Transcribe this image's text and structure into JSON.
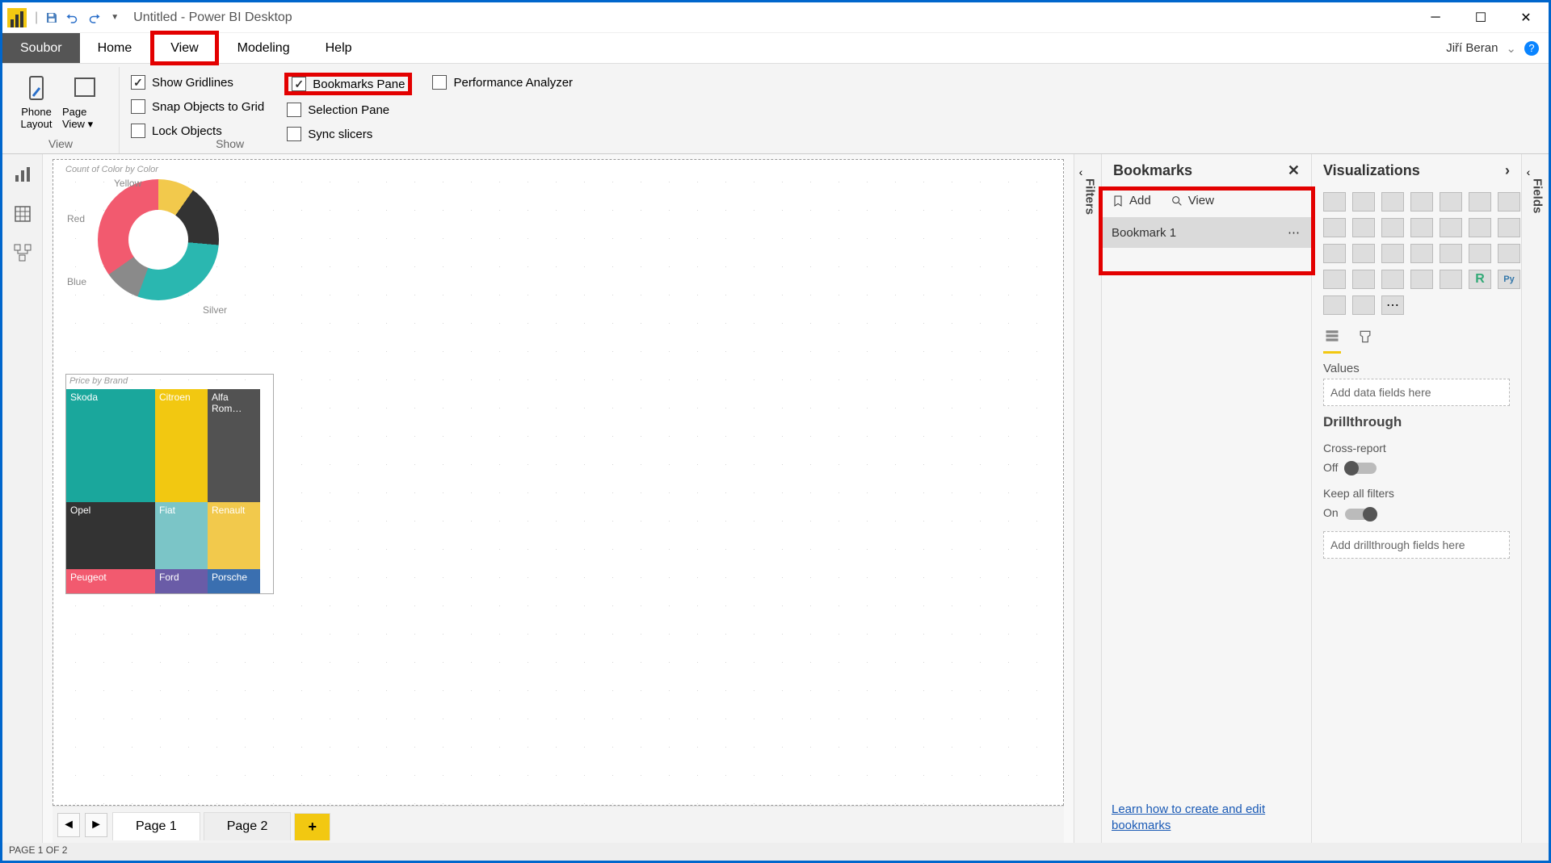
{
  "window": {
    "title": "Untitled - Power BI Desktop",
    "user": "Jiří Beran"
  },
  "menu": {
    "file": "Soubor",
    "home": "Home",
    "view": "View",
    "modeling": "Modeling",
    "help": "Help"
  },
  "ribbon": {
    "view_group": "View",
    "show_group": "Show",
    "phone_layout": "Phone Layout",
    "page_view": "Page View",
    "show_gridlines": "Show Gridlines",
    "snap": "Snap Objects to Grid",
    "lock": "Lock Objects",
    "bookmarks_pane": "Bookmarks Pane",
    "selection_pane": "Selection Pane",
    "sync_slicers": "Sync slicers",
    "perf": "Performance Analyzer"
  },
  "canvas": {
    "chart1_title": "Count of Color by Color",
    "chart1_labels": {
      "yellow": "Yellow",
      "red": "Red",
      "blue": "Blue",
      "silver": "Silver"
    },
    "chart2_title": "Price by Brand",
    "tree": {
      "skoda": "Skoda",
      "citroen": "Citroen",
      "alfa": "Alfa Rom…",
      "opel": "Opel",
      "fiat": "Fiat",
      "renault": "Renault",
      "peugeot": "Peugeot",
      "ford": "Ford",
      "porsche": "Porsche"
    }
  },
  "pages": {
    "p1": "Page 1",
    "p2": "Page 2"
  },
  "status": "PAGE 1 OF 2",
  "filters_label": "Filters",
  "fields_label": "Fields",
  "bookmarks": {
    "title": "Bookmarks",
    "add": "Add",
    "view": "View",
    "item1": "Bookmark 1",
    "learn": "Learn how to create and edit bookmarks"
  },
  "viz": {
    "title": "Visualizations",
    "values": "Values",
    "add_data": "Add data fields here",
    "drill": "Drillthrough",
    "cross": "Cross-report",
    "off": "Off",
    "keep": "Keep all filters",
    "on": "On",
    "add_drill": "Add drillthrough fields here"
  }
}
